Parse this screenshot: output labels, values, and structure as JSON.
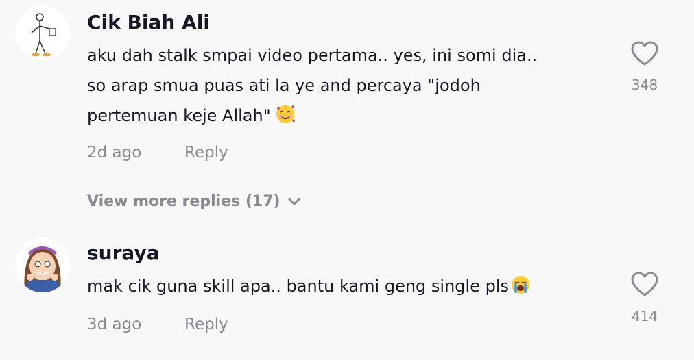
{
  "comments": [
    {
      "username": "Cik Biah Ali",
      "text_lines": [
        "aku dah stalk smpai video pertama.. yes, ini somi dia..",
        "so arap smua puas ati la ye and percaya \"jodoh",
        "pertemuan keje Allah\""
      ],
      "emoji": "smiling-face-with-hearts",
      "time": "2d ago",
      "reply_label": "Reply",
      "like_count": "348"
    },
    {
      "username": "suraya",
      "text_lines": [
        "mak cik guna skill apa.. bantu kami geng single pls"
      ],
      "emoji": "loudly-crying-face",
      "time": "3d ago",
      "reply_label": "Reply",
      "like_count": "414"
    }
  ],
  "view_more_replies": "View more replies (17)",
  "colors": {
    "background": "#f8f8f8",
    "primary_text": "#161823",
    "secondary_text": "#8a8b91"
  }
}
